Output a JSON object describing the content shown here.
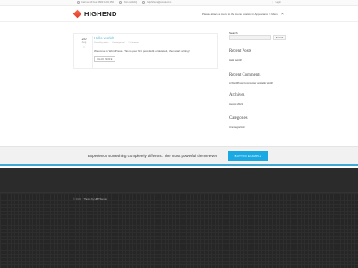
{
  "topbar": {
    "phone": "Call us toll free: 0800 1234 456",
    "faq": "Visit our FAQ",
    "email": "helphiheno@email.com",
    "login": "Login"
  },
  "header": {
    "logo_text": "HIGHEND",
    "menu_notice": "Please attach a menu to the menu location in Appearance > Menu",
    "search_icon": "close-icon"
  },
  "post": {
    "day": "20",
    "month": "Aug",
    "comments": "1",
    "title": "Hello world!",
    "author": "Posted by admin",
    "category": "Uncategorized",
    "comment_count": "1 Comment",
    "excerpt": "Welcome to WordPress. This is your first post. Edit or delete it, then start writing!",
    "read_more": "READ MORE"
  },
  "sidebar": {
    "search_label": "Search",
    "search_button": "Search",
    "recent_posts_title": "Recent Posts",
    "recent_post": "Hello world!",
    "recent_comments_title": "Recent Comments",
    "recent_comment": "A WordPress Commenter on Hello world!",
    "archives_title": "Archives",
    "archive_item": "August 2021",
    "categories_title": "Categories",
    "category_item": "Uncategorized"
  },
  "cta": {
    "text": "Experience something completely different. The most powerful theme ever.",
    "button": "BUTTON EXAMPLE",
    "accent_color": "#1aa9e3"
  },
  "footer": {
    "copyright": "© 2021",
    "theme_credit": "Theme by HB-Themes"
  }
}
